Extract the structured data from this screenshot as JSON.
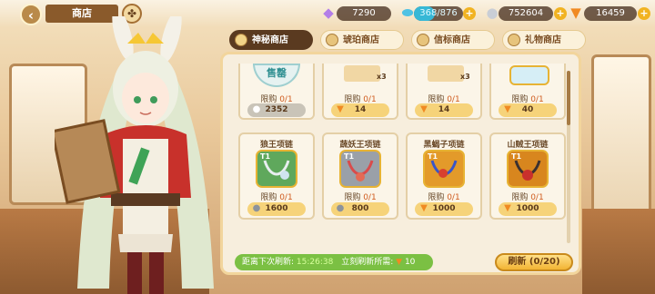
{
  "header": {
    "title": "商店",
    "back_icon": "back-arrow-icon",
    "resources": [
      {
        "name": "gem",
        "icon": "crystal-icon",
        "value": "7290"
      },
      {
        "name": "stamina",
        "icon": "stamina-bottle-icon",
        "value": "368/876",
        "fill": 0.42
      },
      {
        "name": "coin",
        "icon": "coin-icon",
        "value": "752604"
      },
      {
        "name": "carrot",
        "icon": "carrot-icon",
        "value": "16459"
      }
    ]
  },
  "tabs": [
    {
      "label": "神秘商店",
      "active": true
    },
    {
      "label": "琥珀商店",
      "active": false
    },
    {
      "label": "信标商店",
      "active": false
    },
    {
      "label": "礼物商店",
      "active": false
    }
  ],
  "limit_label": "限购",
  "top_row": [
    {
      "badge": "售罄",
      "limit": "0/1",
      "price": "2352",
      "currency": "coin",
      "sold_out": true
    },
    {
      "qty": "x3",
      "limit": "0/1",
      "price": "14",
      "currency": "carrot"
    },
    {
      "qty": "x3",
      "limit": "0/1",
      "price": "14",
      "currency": "carrot"
    },
    {
      "qty": "",
      "limit": "0/1",
      "price": "40",
      "currency": "carrot"
    }
  ],
  "items": [
    {
      "name": "狼王项链",
      "level": "T1",
      "limit": "0/1",
      "price": "1600",
      "currency": "coin",
      "color": "#5fa85c"
    },
    {
      "name": "蔬妖王项链",
      "level": "T1",
      "limit": "0/1",
      "price": "800",
      "currency": "coin",
      "color": "#9aa0a8"
    },
    {
      "name": "黑蝎子项链",
      "level": "T1",
      "limit": "0/1",
      "price": "1000",
      "currency": "carrot",
      "color": "#e39a2a"
    },
    {
      "name": "山贼王项链",
      "level": "T1",
      "limit": "0/1",
      "price": "1000",
      "currency": "carrot",
      "color": "#d8861e"
    }
  ],
  "footer": {
    "next_refresh_label": "距离下次刷新:",
    "next_refresh_time": "15:26:38",
    "refresh_cost_label": "立刻刷新所需:",
    "refresh_cost": "10",
    "refresh_button": "刷新 (0/20)"
  }
}
